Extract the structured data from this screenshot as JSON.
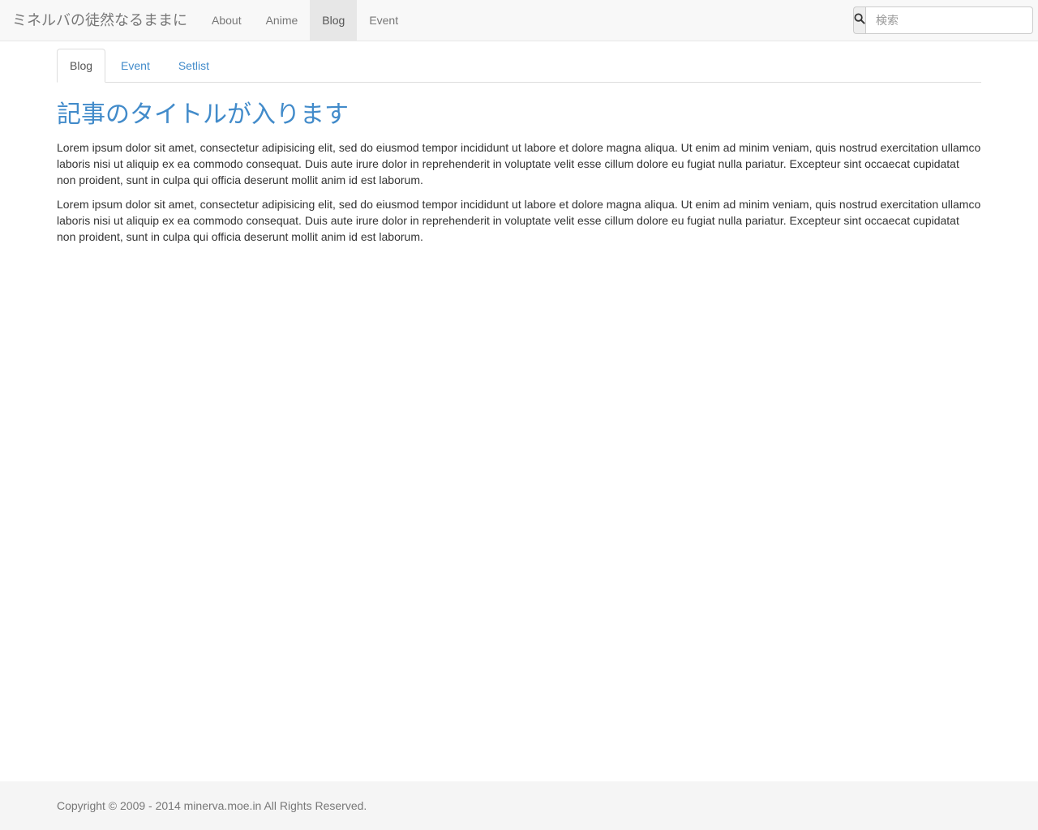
{
  "navbar": {
    "brand": "ミネルバの徒然なるままに",
    "items": [
      {
        "label": "About"
      },
      {
        "label": "Anime"
      },
      {
        "label": "Blog"
      },
      {
        "label": "Event"
      }
    ],
    "active_item": "Blog",
    "search": {
      "placeholder": "検索",
      "value": "",
      "icon": "search-icon"
    }
  },
  "tabs": {
    "items": [
      {
        "label": "Blog"
      },
      {
        "label": "Event"
      },
      {
        "label": "Setlist"
      }
    ],
    "active_tab": "Blog"
  },
  "article": {
    "title": "記事のタイトルが入ります",
    "paragraphs": [
      "Lorem ipsum dolor sit amet, consectetur adipisicing elit, sed do eiusmod tempor incididunt ut labore et dolore magna aliqua. Ut enim ad minim veniam, quis nostrud exercitation ullamco laboris nisi ut aliquip ex ea commodo consequat. Duis aute irure dolor in reprehenderit in voluptate velit esse cillum dolore eu fugiat nulla pariatur. Excepteur sint occaecat cupidatat non proident, sunt in culpa qui officia deserunt mollit anim id est laborum.",
      "Lorem ipsum dolor sit amet, consectetur adipisicing elit, sed do eiusmod tempor incididunt ut labore et dolore magna aliqua. Ut enim ad minim veniam, quis nostrud exercitation ullamco laboris nisi ut aliquip ex ea commodo consequat. Duis aute irure dolor in reprehenderit in voluptate velit esse cillum dolore eu fugiat nulla pariatur. Excepteur sint occaecat cupidatat non proident, sunt in culpa qui officia deserunt mollit anim id est laborum."
    ]
  },
  "footer": {
    "copyright": "Copyright © 2009 - 2014 minerva.moe.in All Rights Reserved."
  },
  "colors": {
    "navbar_bg": "#f8f8f8",
    "link": "#428bca",
    "text": "#333333",
    "muted": "#777777",
    "active_nav_bg": "#e7e7e7",
    "footer_bg": "#f5f5f5"
  }
}
